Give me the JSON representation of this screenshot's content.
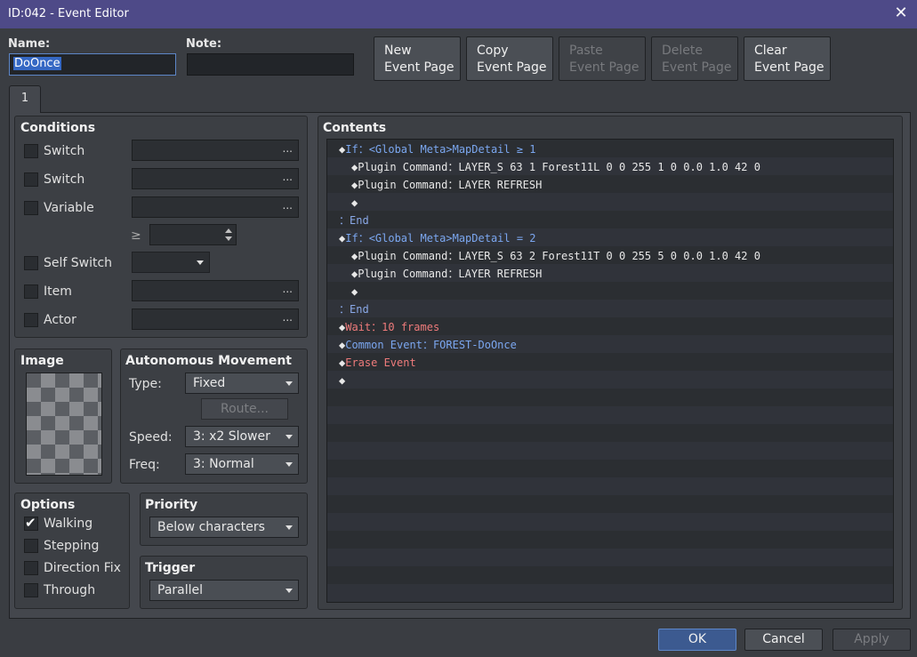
{
  "window": {
    "title": "ID:042 - Event Editor",
    "close_glyph": "✕"
  },
  "name": {
    "label": "Name:",
    "value": "DoOnce"
  },
  "note": {
    "label": "Note:",
    "value": ""
  },
  "page_buttons": {
    "new": [
      "New",
      "Event Page"
    ],
    "copy": [
      "Copy",
      "Event Page"
    ],
    "paste": [
      "Paste",
      "Event Page"
    ],
    "delete": [
      "Delete",
      "Event Page"
    ],
    "clear": [
      "Clear",
      "Event Page"
    ]
  },
  "tabs": [
    "1"
  ],
  "conditions": {
    "title": "Conditions",
    "switch1": "Switch",
    "switch2": "Switch",
    "variable": "Variable",
    "gte": "≥",
    "self_switch": "Self Switch",
    "item": "Item",
    "actor": "Actor",
    "dots": "..."
  },
  "image": {
    "title": "Image"
  },
  "movement": {
    "title": "Autonomous Movement",
    "type_label": "Type:",
    "type_value": "Fixed",
    "route_label": "Route...",
    "speed_label": "Speed:",
    "speed_value": "3: x2 Slower",
    "freq_label": "Freq:",
    "freq_value": "3: Normal"
  },
  "options": {
    "title": "Options",
    "walking": "Walking",
    "stepping": "Stepping",
    "direction_fix": "Direction Fix",
    "through": "Through"
  },
  "priority": {
    "title": "Priority",
    "value": "Below characters"
  },
  "trigger": {
    "title": "Trigger",
    "value": "Parallel"
  },
  "contents": {
    "title": "Contents",
    "lines": {
      "l0_kw": "If",
      "l0_rest": "：<Global Meta>MapDetail ≥ 1",
      "l1_kw": "Plugin Command",
      "l1_rest": "：LAYER_S 63 1 Forest11L 0 0 255 1 0 0.0 1.0 42 0",
      "l2_kw": "Plugin Command",
      "l2_rest": "：LAYER REFRESH",
      "l4_rest": "：End",
      "l5_kw": "If",
      "l5_rest": "：<Global Meta>MapDetail = 2",
      "l6_kw": "Plugin Command",
      "l6_rest": "：LAYER_S 63 2 Forest11T 0 0 255 5 0 0.0 1.0 42 0",
      "l7_kw": "Plugin Command",
      "l7_rest": "：LAYER REFRESH",
      "l9_rest": "：End",
      "l10_kw": "Wait",
      "l10_rest": "：10 frames",
      "l11_kw": "Common Event",
      "l11_rest": "：FOREST-DoOnce",
      "l12_kw": "Erase Event"
    }
  },
  "footer": {
    "ok": "OK",
    "cancel": "Cancel",
    "apply": "Apply"
  }
}
